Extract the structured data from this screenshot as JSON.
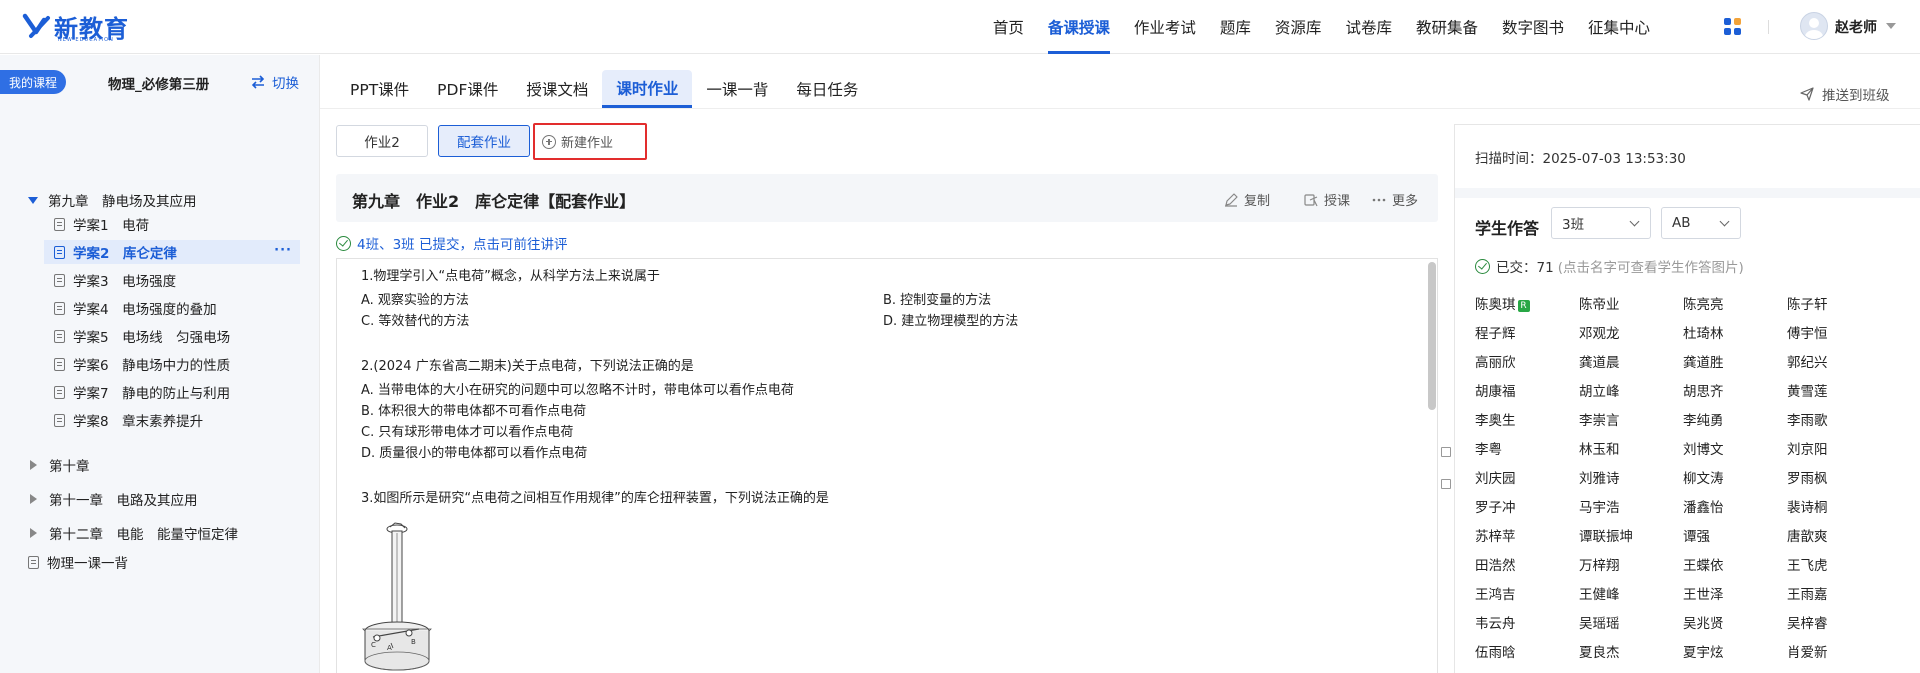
{
  "header": {
    "logo_text": "新教育",
    "logo_subtext": "NEW EDUCATION",
    "nav": [
      "首页",
      "备课授课",
      "作业考试",
      "题库",
      "资源库",
      "试卷库",
      "教研集备",
      "数字图书",
      "征集中心"
    ],
    "active_nav_index": 1,
    "user_name": "赵老师",
    "accent_color": "#1c5ed6"
  },
  "sidebar": {
    "my_course_label": "我的课程",
    "course_name": "物理_必修第三册",
    "switch_label": "切换",
    "chapters": [
      {
        "label": "第九章　静电场及其应用",
        "expanded": true,
        "items": [
          {
            "label": "学案1　电荷"
          },
          {
            "label": "学案2　库仑定律",
            "active": true
          },
          {
            "label": "学案3　电场强度"
          },
          {
            "label": "学案4　电场强度的叠加"
          },
          {
            "label": "学案5　电场线　匀强电场"
          },
          {
            "label": "学案6　静电场中力的性质"
          },
          {
            "label": "学案7　静电的防止与利用"
          },
          {
            "label": "学案8　章末素养提升"
          }
        ]
      },
      {
        "label": "第十章",
        "expanded": false
      },
      {
        "label": "第十一章　电路及其应用",
        "expanded": false
      },
      {
        "label": "第十二章　电能　能量守恒定律",
        "expanded": false
      }
    ],
    "extra_item": "物理一课一背",
    "more_glyph": "···"
  },
  "tabs": [
    "PPT课件",
    "PDF课件",
    "授课文档",
    "课时作业",
    "一课一背",
    "每日任务"
  ],
  "active_tab_index": 3,
  "push_label": "推送到班级",
  "homework_buttons": [
    "作业2",
    "配套作业"
  ],
  "new_homework_label": "新建作业",
  "title": "第九章　作业2　库仑定律【配套作业】",
  "title_actions": [
    "复制",
    "授课",
    "更多"
  ],
  "submit_status": "4班、3班 已提交，点击可前往讲评",
  "questions": [
    {
      "stem": "1.物理学引入“点电荷”概念，从科学方法上来说属于",
      "options": [
        "A. 观察实验的方法",
        "B. 控制变量的方法",
        "C. 等效替代的方法",
        "D. 建立物理模型的方法"
      ]
    },
    {
      "stem": "2.(2024 广东省高二期末)关于点电荷，下列说法正确的是",
      "options": [
        "A. 当带电体的大小在研究的问题中可以忽略不计时，带电体可以看作点电荷",
        "B. 体积很大的带电体都不可看作点电荷",
        "C. 只有球形带电体才可以看作点电荷",
        "D. 质量很小的带电体都可以看作点电荷"
      ]
    },
    {
      "stem": "3.如图所示是研究“点电荷之间相互作用规律”的库仑扭秤装置，下列说法正确的是",
      "options": []
    }
  ],
  "figure_labels": [
    "C",
    "A",
    "B"
  ],
  "right_panel": {
    "scan_time": "扫描时间：2025-07-03 13:53:30",
    "student_work_title": "学生作答",
    "class_select": "3班",
    "group_select": "AB",
    "submitted_label": "已交：71",
    "submitted_hint": "(点击名字可查看学生作答图片)",
    "badge_text": "R",
    "students": [
      "陈奥琪",
      "陈帝业",
      "陈亮亮",
      "陈子轩",
      "程子辉",
      "邓观龙",
      "杜琦林",
      "傅宇恒",
      "高丽欣",
      "龚道晨",
      "龚道胜",
      "郭纪兴",
      "胡康福",
      "胡立峰",
      "胡思齐",
      "黄雪莲",
      "李奥生",
      "李崇言",
      "李纯勇",
      "李雨歌",
      "李粤",
      "林玉和",
      "刘博文",
      "刘京阳",
      "刘庆园",
      "刘雅诗",
      "柳文涛",
      "罗雨枫",
      "罗子冲",
      "马宇浩",
      "潘鑫怡",
      "裴诗桐",
      "苏梓苹",
      "谭联振坤",
      "谭强",
      "唐歆爽",
      "田浩然",
      "万梓翔",
      "王蝶依",
      "王飞虎",
      "王鸿吉",
      "王健峰",
      "王世泽",
      "王雨嘉",
      "韦云舟",
      "吴瑶瑶",
      "吴兆贤",
      "吴梓睿",
      "伍雨晗",
      "夏良杰",
      "夏宇炫",
      "肖爱新"
    ]
  }
}
